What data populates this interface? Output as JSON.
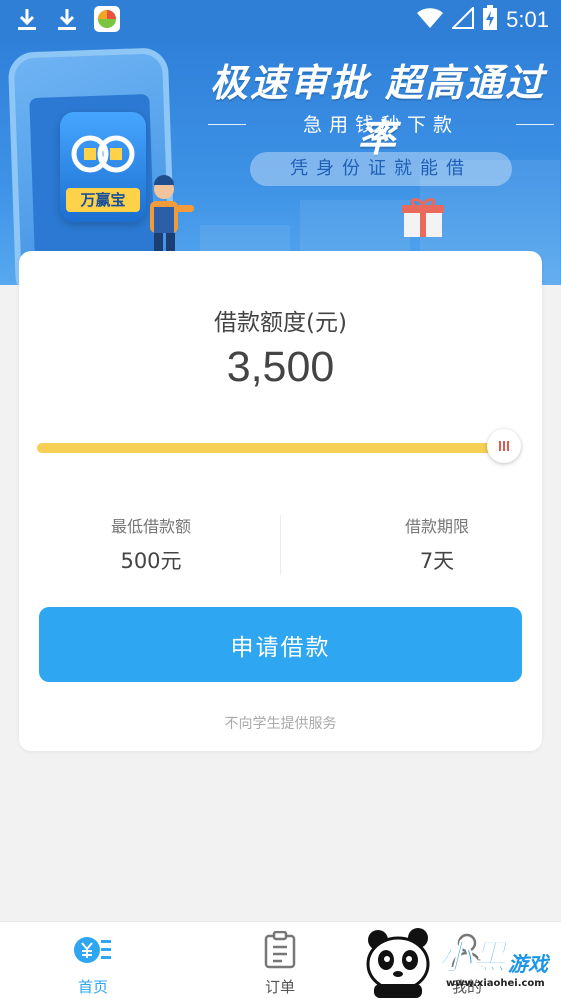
{
  "status_bar": {
    "time": "5:01",
    "left_icons": [
      "download-icon",
      "download-icon",
      "app-store-icon"
    ],
    "right_icons": [
      "wifi-icon",
      "signal-icon",
      "battery-charging-icon"
    ]
  },
  "banner": {
    "title": "极速审批 超高通过率",
    "subtitle": "急用钱秒下款",
    "pill": "凭身份证就能借",
    "app_logo_name": "万赢宝"
  },
  "loan": {
    "amount_label": "借款额度(元)",
    "amount_value": "3,500",
    "slider_level": 1.0,
    "min_label": "最低借款额",
    "min_value": "500元",
    "term_label": "借款期限",
    "term_value": "7天",
    "apply_button": "申请借款",
    "notice": "不向学生提供服务"
  },
  "bottom_nav": {
    "items": [
      {
        "label": "首页",
        "icon": "home-yen-icon",
        "active": true
      },
      {
        "label": "订单",
        "icon": "order-clipboard-icon",
        "active": false
      },
      {
        "label": "我的",
        "icon": "profile-icon",
        "active": false
      }
    ]
  },
  "watermark": {
    "brand_large": "小黑",
    "brand_small": "游戏",
    "url": "www.xiaohei.com"
  },
  "colors": {
    "primary": "#2fa6f1",
    "banner_blue": "#2f80d9",
    "slider_yellow": "#f7cf55",
    "thumb_red": "#e05a4e"
  }
}
